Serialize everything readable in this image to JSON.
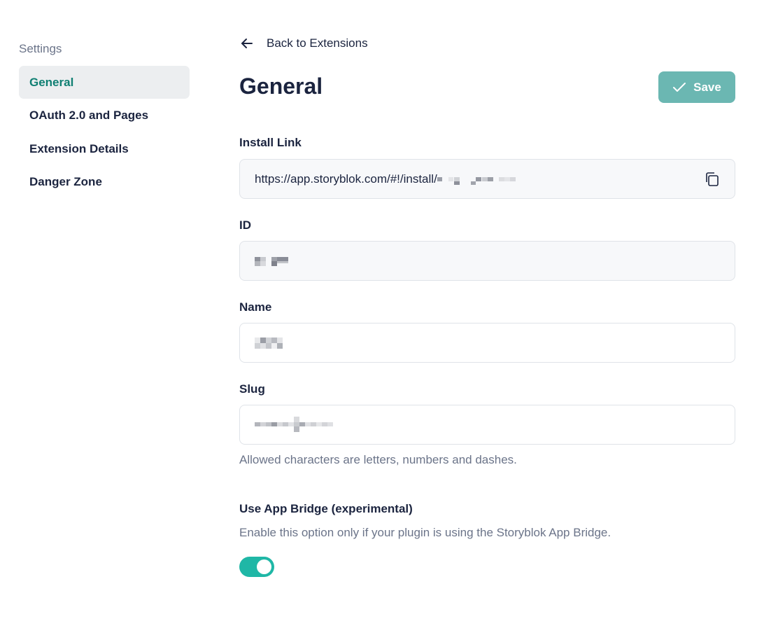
{
  "sidebar": {
    "heading": "Settings",
    "items": [
      {
        "label": "General",
        "active": true
      },
      {
        "label": "OAuth 2.0 and Pages",
        "active": false
      },
      {
        "label": "Extension Details",
        "active": false
      },
      {
        "label": "Danger Zone",
        "active": false
      }
    ]
  },
  "header": {
    "back_label": "Back to Extensions",
    "title": "General",
    "save_label": "Save"
  },
  "fields": {
    "install_link": {
      "label": "Install Link",
      "value": "https://app.storyblok.com/#!/install/"
    },
    "id": {
      "label": "ID",
      "value": ""
    },
    "name": {
      "label": "Name",
      "value": ""
    },
    "slug": {
      "label": "Slug",
      "value": "",
      "help": "Allowed characters are letters, numbers and dashes."
    },
    "app_bridge": {
      "label": "Use App Bridge (experimental)",
      "help": "Enable this option only if your plugin is using the Storyblok App Bridge.",
      "enabled": true
    }
  },
  "colors": {
    "accent": "#1fb7a6",
    "active_nav_text": "#0f7f72",
    "save_button": "#6bb7b2",
    "text": "#1b243f",
    "muted": "#6b7489"
  }
}
